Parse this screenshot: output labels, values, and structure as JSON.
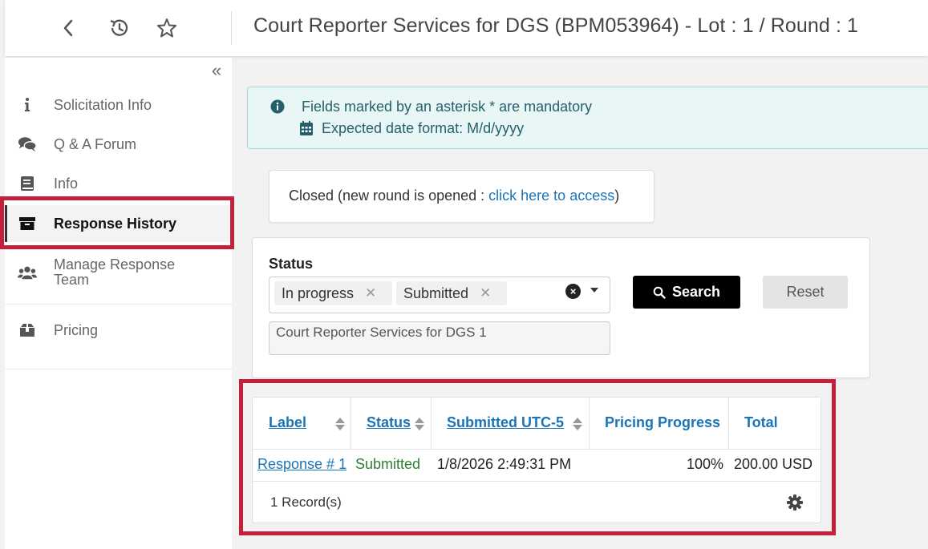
{
  "header": {
    "title": "Court Reporter Services for DGS (BPM053964) - Lot : 1 / Round : 1",
    "icons": [
      "chevron-left-icon",
      "history-icon",
      "star-icon"
    ]
  },
  "sidebar": {
    "collapse_label": "«",
    "items": [
      {
        "label": "Solicitation Info",
        "icon": "info-icon"
      },
      {
        "label": "Q & A Forum",
        "icon": "comments-icon"
      },
      {
        "label": "Info",
        "icon": "book-icon"
      },
      {
        "label": "Response History",
        "icon": "archive-icon",
        "active": true
      },
      {
        "label": "Manage Response Team",
        "icon": "users-icon"
      },
      {
        "label": "Pricing",
        "icon": "box-icon"
      }
    ]
  },
  "info_banner": {
    "mandatory_text": "Fields marked by an asterisk * are mandatory",
    "date_format_text": "Expected date format: M/d/yyyy"
  },
  "closed_notice": {
    "prefix": "Closed (new round is opened : ",
    "link_text": "click here to access",
    "suffix": ")"
  },
  "filter": {
    "status_label": "Status",
    "selected_statuses": [
      "In progress",
      "Submitted"
    ],
    "chip_remove": "✕",
    "clear_all": "×",
    "text_value": "Court Reporter Services for DGS 1",
    "search_label": "Search",
    "reset_label": "Reset"
  },
  "table": {
    "columns": [
      "Label",
      "Status",
      "Submitted UTC-5",
      "Pricing Progress",
      "Total"
    ],
    "rows": [
      {
        "label": "Response # 1",
        "status": "Submitted",
        "submitted": "1/8/2026 2:49:31 PM",
        "pricing_progress": "100%",
        "total": "200.00 USD"
      }
    ],
    "records_text": "1 Record(s)"
  },
  "colors": {
    "accent_blue": "#1b74b8",
    "highlight_red": "#c4203b",
    "status_green": "#2e7d32",
    "banner_bg": "#e9f6f6"
  }
}
